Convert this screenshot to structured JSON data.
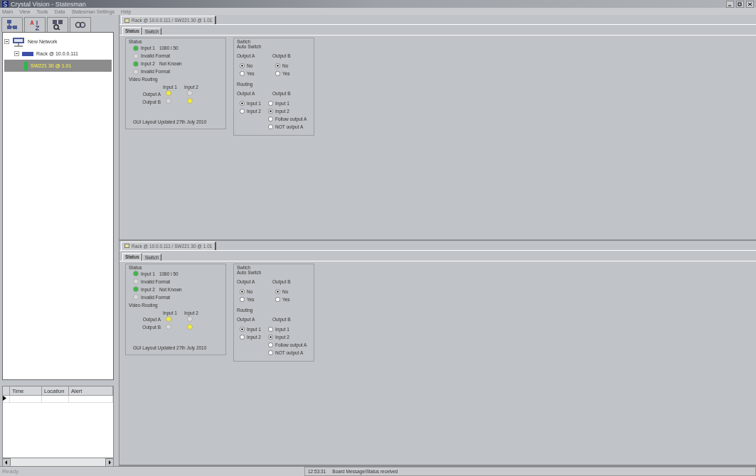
{
  "window": {
    "title": "Crystal Vision - Statesman"
  },
  "menu": [
    "Main",
    "View",
    "Tools",
    "Data",
    "Statesman Settings",
    "Help"
  ],
  "tree": [
    {
      "label": "New Network",
      "expanded": true,
      "selected": false,
      "children": [
        {
          "label": "Rack @ 10.0.0.111",
          "expanded": true,
          "selected": false,
          "children": [
            {
              "label": "SW221 30 @ 1.01",
              "selected": true
            }
          ]
        }
      ]
    }
  ],
  "alerts": {
    "columns": [
      "Time",
      "Location",
      "Alert"
    ]
  },
  "panels": [
    {
      "tab": "Rack @ 10.0.0.111 / SW221 30 @ 1.01",
      "subtabs": [
        {
          "label": "Status",
          "selected": true
        },
        {
          "label": "Switch",
          "selected": false
        }
      ],
      "status": {
        "title": "Status",
        "inputs": [
          {
            "label": "Input 1",
            "value": "1080 i 50",
            "on": true
          },
          {
            "label": "Invalid Format",
            "on": false
          },
          {
            "label": "Input 2",
            "value": "Not Known",
            "on": true
          },
          {
            "label": "Invalid Format",
            "on": false
          }
        ],
        "routing_title": "Video Routing",
        "routing_columns": [
          "Input 1",
          "Input 2"
        ],
        "routing_rows": [
          {
            "label": "Output A",
            "lamps": [
              true,
              false
            ]
          },
          {
            "label": "Output B",
            "lamps": [
              false,
              true
            ]
          }
        ],
        "note": "GUI Layout Updated 27th July 2010"
      },
      "switch": {
        "title": "Switch",
        "auto_title": "Auto Switch",
        "auto": [
          {
            "heading": "Output A",
            "options": [
              {
                "label": "No",
                "selected": true
              },
              {
                "label": "Yes",
                "selected": false
              }
            ]
          },
          {
            "heading": "Output B",
            "options": [
              {
                "label": "No",
                "selected": true
              },
              {
                "label": "Yes",
                "selected": false
              }
            ]
          }
        ],
        "routing_title": "Routing",
        "routing": [
          {
            "heading": "Output A",
            "options": [
              {
                "label": "Input 1",
                "selected": true
              },
              {
                "label": "Input 2",
                "selected": false
              }
            ]
          },
          {
            "heading": "Output B",
            "options": [
              {
                "label": "Input 1",
                "selected": false
              },
              {
                "label": "Input 2",
                "selected": true
              },
              {
                "label": "Follow output A",
                "selected": false
              },
              {
                "label": "NOT output A",
                "selected": false
              }
            ]
          }
        ]
      }
    },
    {
      "tab": "Rack @ 10.0.0.111 / SW221 30 @ 1.01",
      "subtabs": [
        {
          "label": "Status",
          "selected": true
        },
        {
          "label": "Switch",
          "selected": false
        }
      ],
      "status": {
        "title": "Status",
        "inputs": [
          {
            "label": "Input 1",
            "value": "1080 i 50",
            "on": true
          },
          {
            "label": "Invalid Format",
            "on": false
          },
          {
            "label": "Input 2",
            "value": "Not Known",
            "on": true
          },
          {
            "label": "Invalid Format",
            "on": false
          }
        ],
        "routing_title": "Video Routing",
        "routing_columns": [
          "Input 1",
          "Input 2"
        ],
        "routing_rows": [
          {
            "label": "Output A",
            "lamps": [
              true,
              false
            ]
          },
          {
            "label": "Output B",
            "lamps": [
              false,
              true
            ]
          }
        ],
        "note": "GUI Layout Updated 27th July 2010"
      },
      "switch": {
        "title": "Switch",
        "auto_title": "Auto Switch",
        "auto": [
          {
            "heading": "Output A",
            "options": [
              {
                "label": "No",
                "selected": true
              },
              {
                "label": "Yes",
                "selected": false
              }
            ]
          },
          {
            "heading": "Output B",
            "options": [
              {
                "label": "No",
                "selected": true
              },
              {
                "label": "Yes",
                "selected": false
              }
            ]
          }
        ],
        "routing_title": "Routing",
        "routing": [
          {
            "heading": "Output A",
            "options": [
              {
                "label": "Input 1",
                "selected": true
              },
              {
                "label": "Input 2",
                "selected": false
              }
            ]
          },
          {
            "heading": "Output B",
            "options": [
              {
                "label": "Input 1",
                "selected": false
              },
              {
                "label": "Input 2",
                "selected": true
              },
              {
                "label": "Follow output A",
                "selected": false
              },
              {
                "label": "NOT output A",
                "selected": false
              }
            ]
          }
        ]
      }
    }
  ],
  "status_bar": {
    "left": "Ready",
    "time": "12:53:31",
    "message": "Board Message/Status received"
  }
}
